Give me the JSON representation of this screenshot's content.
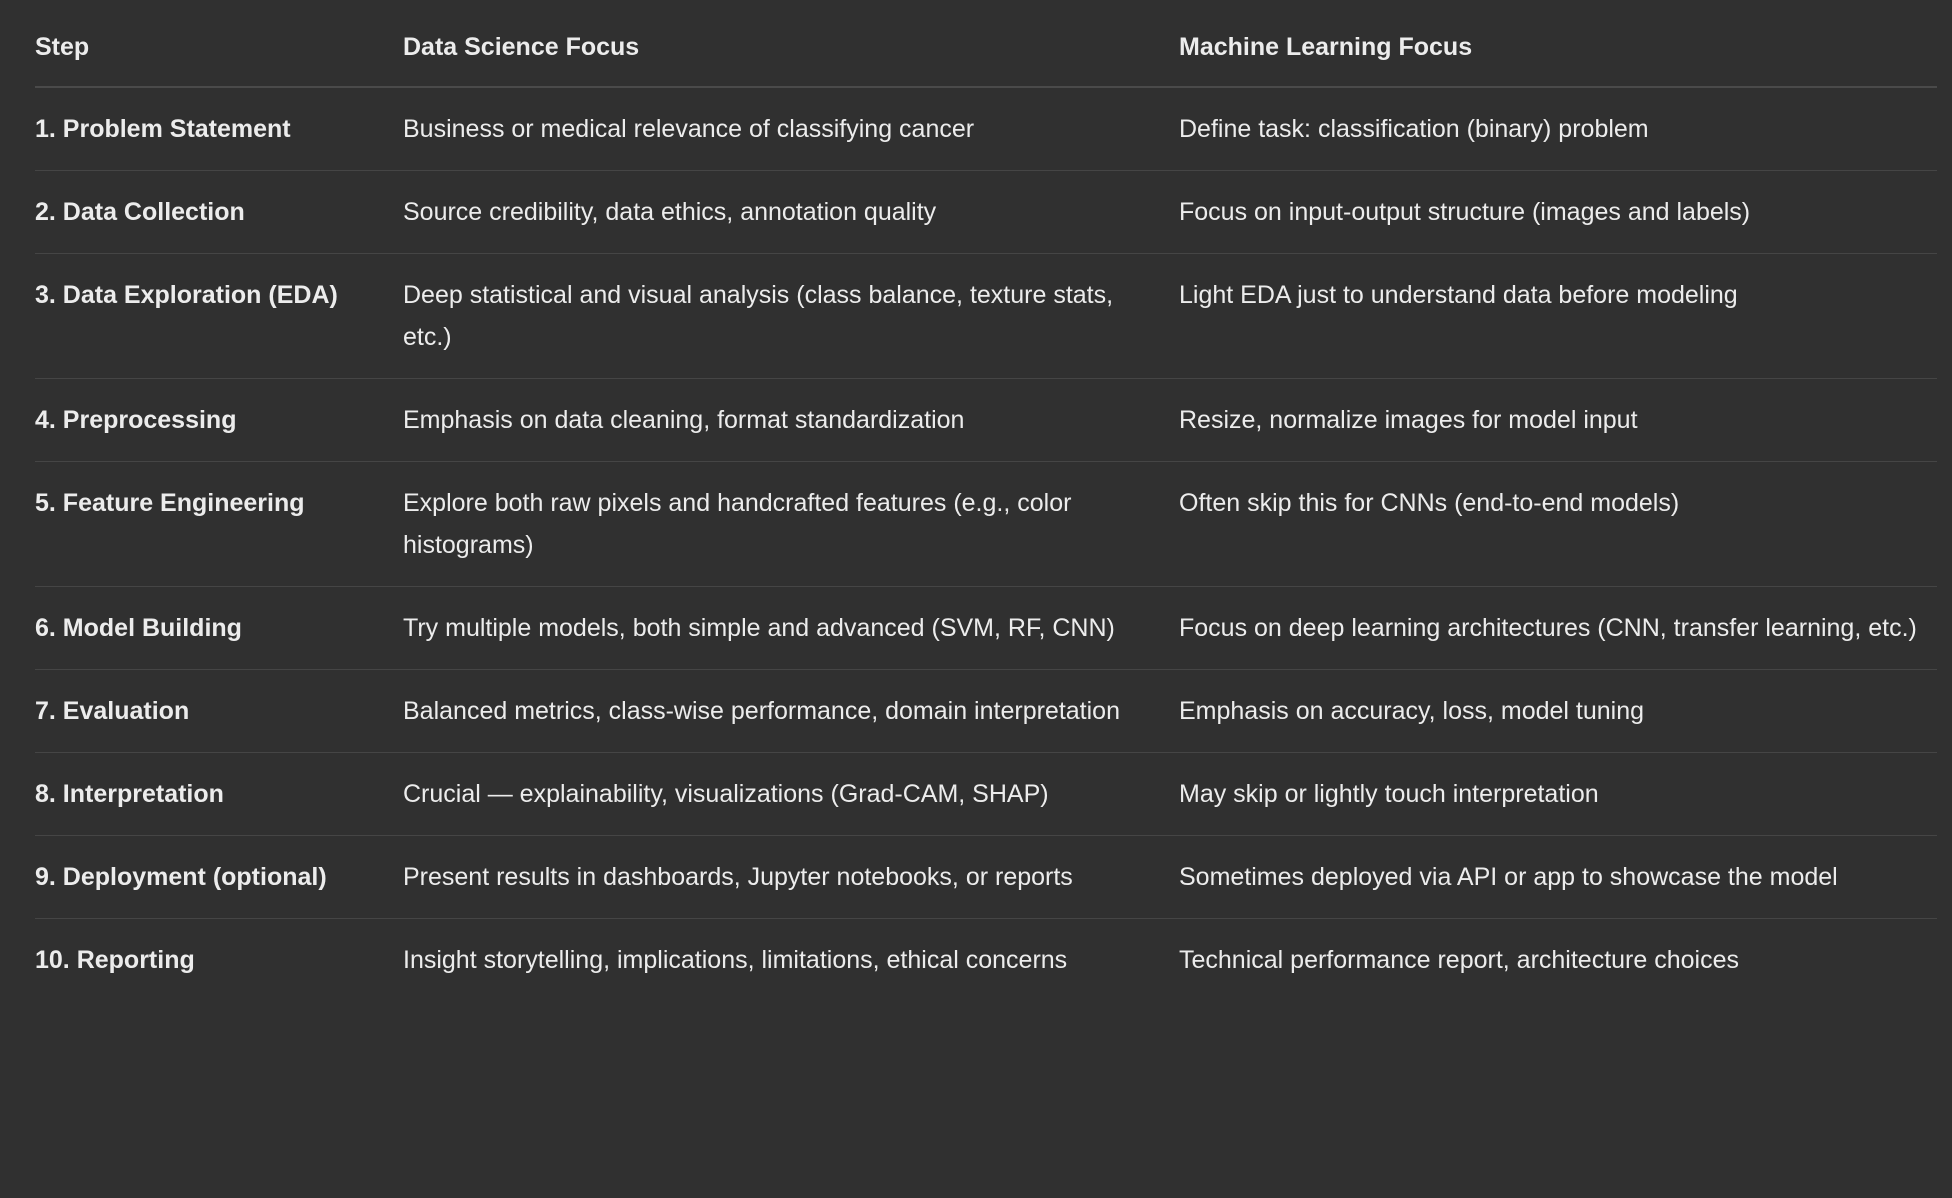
{
  "table": {
    "headers": [
      "Step",
      "Data Science Focus",
      "Machine Learning Focus"
    ],
    "rows": [
      [
        "1. Problem Statement",
        "Business or medical relevance of classifying cancer",
        "Define task: classification (binary) problem"
      ],
      [
        "2. Data Collection",
        "Source credibility, data ethics, annotation quality",
        "Focus on input-output structure (images and labels)"
      ],
      [
        "3. Data Exploration (EDA)",
        "Deep statistical and visual analysis (class balance, texture stats, etc.)",
        "Light EDA just to understand data before modeling"
      ],
      [
        "4. Preprocessing",
        "Emphasis on data cleaning, format standardization",
        "Resize, normalize images for model input"
      ],
      [
        "5. Feature Engineering",
        "Explore both raw pixels and handcrafted features (e.g., color histograms)",
        "Often skip this for CNNs (end-to-end models)"
      ],
      [
        "6. Model Building",
        "Try multiple models, both simple and advanced (SVM, RF, CNN)",
        "Focus on deep learning architectures (CNN, transfer learning, etc.)"
      ],
      [
        "7. Evaluation",
        "Balanced metrics, class-wise performance, domain interpretation",
        "Emphasis on accuracy, loss, model tuning"
      ],
      [
        "8. Interpretation",
        "Crucial — explainability, visualizations (Grad-CAM, SHAP)",
        "May skip or lightly touch interpretation"
      ],
      [
        "9. Deployment (optional)",
        "Present results in dashboards, Jupyter notebooks, or reports",
        "Sometimes deployed via API or app to showcase the model"
      ],
      [
        "10. Reporting",
        "Insight storytelling, implications, limitations, ethical concerns",
        "Technical performance report, architecture choices"
      ]
    ]
  }
}
